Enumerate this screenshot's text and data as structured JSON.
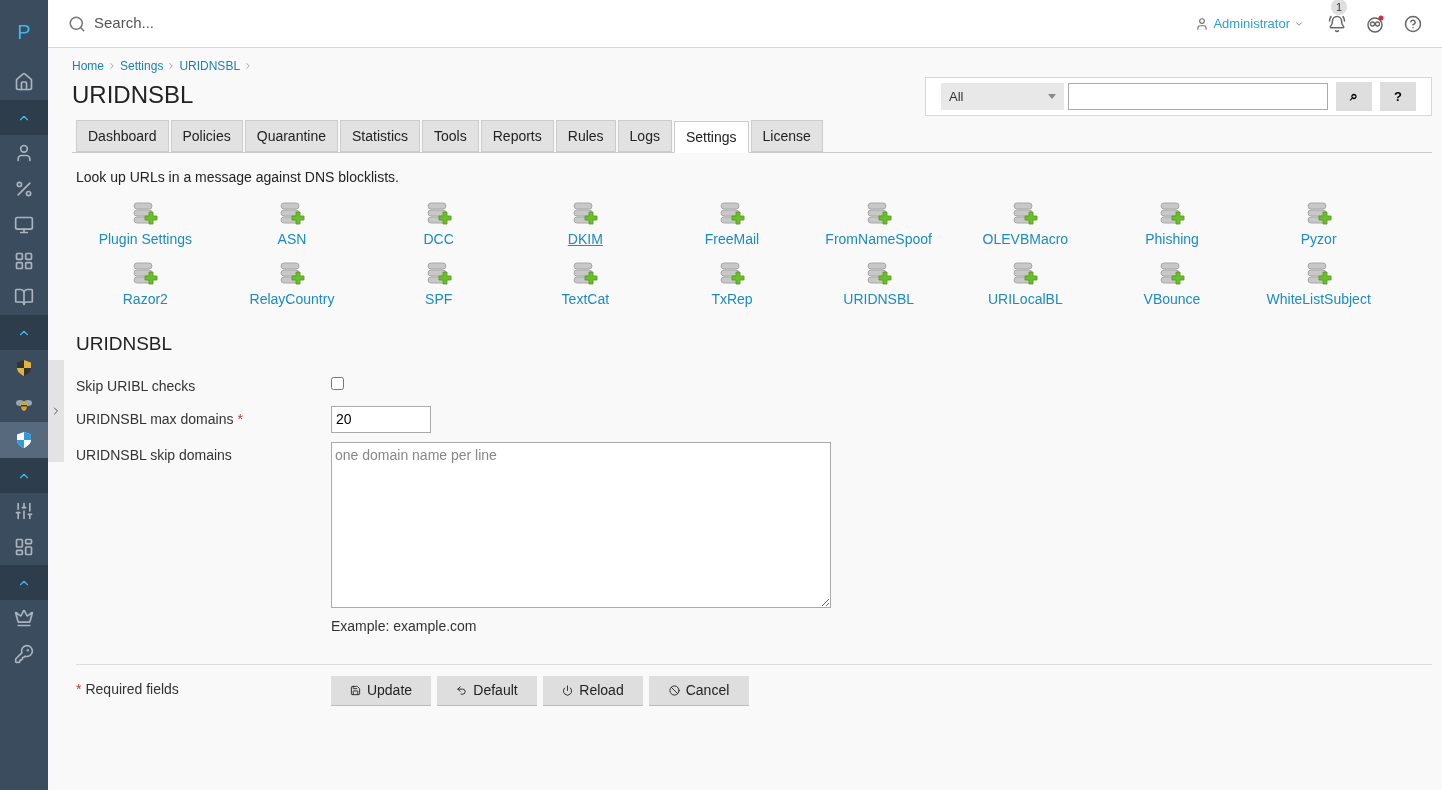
{
  "sidebar": {
    "logo": "P",
    "items": [
      {
        "kind": "icon",
        "selected": false
      },
      {
        "kind": "section",
        "selected": false
      },
      {
        "kind": "icon",
        "selected": false
      },
      {
        "kind": "icon",
        "selected": false
      },
      {
        "kind": "icon",
        "selected": false
      },
      {
        "kind": "icon",
        "selected": false
      },
      {
        "kind": "icon",
        "selected": false
      },
      {
        "kind": "section",
        "selected": false
      },
      {
        "kind": "icon",
        "selected": false
      },
      {
        "kind": "icon",
        "selected": false
      },
      {
        "kind": "icon",
        "selected": true
      },
      {
        "kind": "section",
        "selected": false
      },
      {
        "kind": "icon",
        "selected": false
      },
      {
        "kind": "icon",
        "selected": false
      },
      {
        "kind": "section",
        "selected": false
      },
      {
        "kind": "icon",
        "selected": false
      },
      {
        "kind": "icon",
        "selected": false
      }
    ]
  },
  "topbar": {
    "search": {
      "placeholder": "Search..."
    },
    "user": "Administrator",
    "notifications": "1"
  },
  "breadcrumb": [
    "Home",
    "Settings",
    "URIDNSBL"
  ],
  "title": "URIDNSBL",
  "quick_search": {
    "scope": "All",
    "search_button": "⌕",
    "help_button": "?"
  },
  "tabs": [
    {
      "label": "Dashboard",
      "selected": false
    },
    {
      "label": "Policies",
      "selected": false
    },
    {
      "label": "Quarantine",
      "selected": false
    },
    {
      "label": "Statistics",
      "selected": false
    },
    {
      "label": "Tools",
      "selected": false
    },
    {
      "label": "Reports",
      "selected": false
    },
    {
      "label": "Rules",
      "selected": false
    },
    {
      "label": "Logs",
      "selected": false
    },
    {
      "label": "Settings",
      "selected": true
    },
    {
      "label": "License",
      "selected": false
    }
  ],
  "description": "Look up URLs in a message against DNS blocklists.",
  "plugins": [
    {
      "label": "Plugin Settings",
      "hovered": false
    },
    {
      "label": "ASN",
      "hovered": false
    },
    {
      "label": "DCC",
      "hovered": false
    },
    {
      "label": "DKIM",
      "hovered": true
    },
    {
      "label": "FreeMail",
      "hovered": false
    },
    {
      "label": "FromNameSpoof",
      "hovered": false
    },
    {
      "label": "OLEVBMacro",
      "hovered": false
    },
    {
      "label": "Phishing",
      "hovered": false
    },
    {
      "label": "Pyzor",
      "hovered": false
    },
    {
      "label": "Razor2",
      "hovered": false
    },
    {
      "label": "RelayCountry",
      "hovered": false
    },
    {
      "label": "SPF",
      "hovered": false
    },
    {
      "label": "TextCat",
      "hovered": false
    },
    {
      "label": "TxRep",
      "hovered": false
    },
    {
      "label": "URIDNSBL",
      "hovered": false
    },
    {
      "label": "URILocalBL",
      "hovered": false
    },
    {
      "label": "VBounce",
      "hovered": false
    },
    {
      "label": "WhiteListSubject",
      "hovered": false
    }
  ],
  "section_title": "URIDNSBL",
  "fields": [
    {
      "kind": "checkbox",
      "label": "Skip URIBL checks",
      "checked": false
    },
    {
      "kind": "text",
      "label": "URIDNSBL max domains",
      "required_mark": "*",
      "value": "20"
    },
    {
      "kind": "textarea",
      "label": "URIDNSBL skip domains",
      "placeholder": "one domain name per line",
      "hint": "Example: example.com"
    }
  ],
  "required_note": "Required fields",
  "required_mark": "*",
  "buttons": [
    {
      "kind": "save",
      "label": "Update"
    },
    {
      "kind": "undo",
      "label": "Default"
    },
    {
      "kind": "power",
      "label": "Reload"
    },
    {
      "kind": "ban",
      "label": "Cancel"
    }
  ]
}
